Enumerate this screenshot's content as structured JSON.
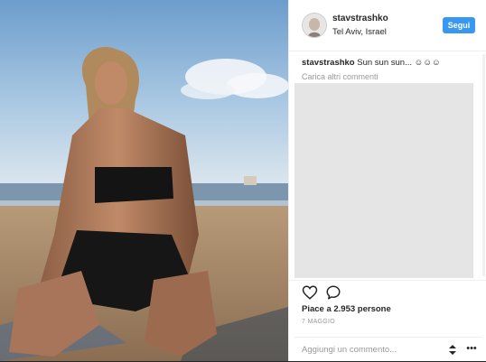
{
  "post": {
    "username": "stavstrashko",
    "location": "Tel Aviv, Israel",
    "follow_label": "Segui",
    "caption_user": "stavstrashko",
    "caption_text": "Sun sun sun... ☺☺☺",
    "load_more_label": "Carica altri commenti",
    "likes_text": "Piace a 2.953 persone",
    "date_text": "7 MAGGIO",
    "comment_placeholder": "Aggiungi un commento...",
    "more_label": "•••"
  },
  "icons": {
    "like": "heart-icon",
    "comment": "comment-bubble-icon",
    "stepper": "stepper-icon",
    "more": "more-icon"
  },
  "colors": {
    "accent": "#3897f0",
    "text": "#262626",
    "muted": "#999999"
  }
}
